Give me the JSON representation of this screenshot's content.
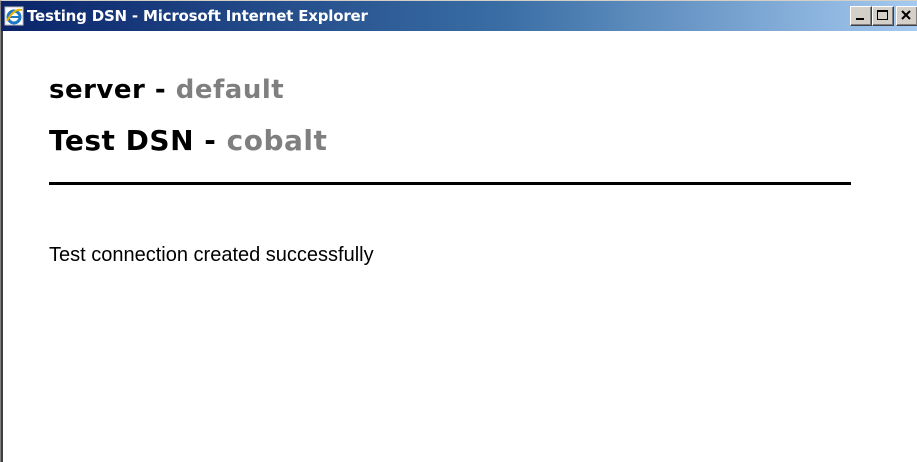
{
  "window": {
    "title": "Testing DSN - Microsoft Internet Explorer",
    "icon": "internet-explorer-icon",
    "controls": {
      "minimize_icon": "minimize-icon",
      "maximize_icon": "maximize-icon",
      "close_icon": "close-icon"
    }
  },
  "page": {
    "server_label": "server - ",
    "server_value": "default",
    "dsn_label": "Test DSN - ",
    "dsn_value": "cobalt",
    "message": "Test connection created successfully"
  },
  "colors": {
    "accent_gray": "#7f7f7f",
    "titlebar_start": "#0a246a",
    "titlebar_end": "#a6caf0"
  }
}
